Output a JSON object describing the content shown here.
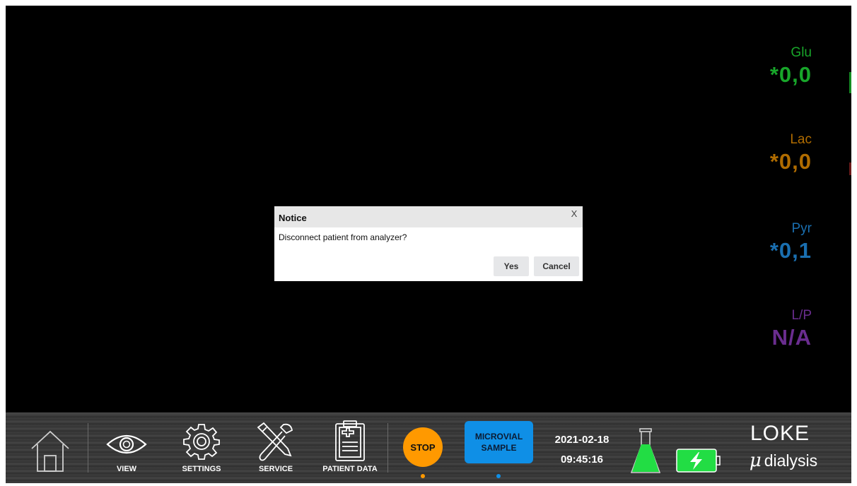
{
  "metrics": [
    {
      "name": "Glu",
      "value": "*0,0",
      "color": "#18a62a"
    },
    {
      "name": "Lac",
      "value": "*0,0",
      "color": "#b06c00"
    },
    {
      "name": "Pyr",
      "value": "*0,1",
      "color": "#1a6fb0"
    },
    {
      "name": "L/P",
      "value": "N/A",
      "color": "#6a2d8f"
    }
  ],
  "dialog": {
    "title": "Notice",
    "close": "X",
    "message": "Disconnect patient from analyzer?",
    "yes": "Yes",
    "cancel": "Cancel"
  },
  "toolbar": {
    "home_icon": "home-icon",
    "view": "VIEW",
    "settings": "SETTINGS",
    "service": "SERVICE",
    "patient_data": "PATIENT DATA",
    "stop": "STOP",
    "microvial_line1": "MICROVIAL",
    "microvial_line2": "SAMPLE",
    "date": "2021-02-18",
    "time": "09:45:16",
    "brand_top": "LOKE",
    "brand_mu": "μ",
    "brand_bottom": "dialysis"
  },
  "colors": {
    "stop": "#ff9900",
    "microvial": "#0f8fe6",
    "flask": "#22dd44",
    "battery": "#22dd44"
  }
}
